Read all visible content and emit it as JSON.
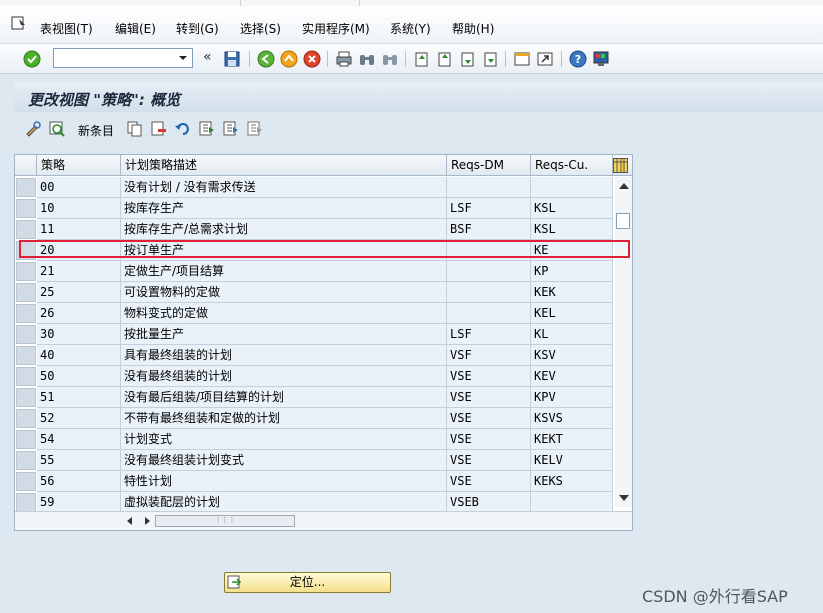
{
  "menubar": {
    "items": [
      "表视图(T)",
      "编辑(E)",
      "转到(G)",
      "选择(S)",
      "实用程序(M)",
      "系统(Y)",
      "帮助(H)"
    ]
  },
  "toolbar": {
    "command_value": "",
    "back_chevron": "«"
  },
  "title": "更改视图 \"策略\": 概览",
  "app_toolbar": {
    "new_entries_label": "新条目"
  },
  "table": {
    "columns": [
      "策略",
      "计划策略描述",
      "Reqs-DM",
      "Reqs-Cu."
    ],
    "rows": [
      {
        "strategy": "00",
        "desc": "没有计划 / 没有需求传送",
        "dm": "",
        "cu": ""
      },
      {
        "strategy": "10",
        "desc": "按库存生产",
        "dm": "LSF",
        "cu": "KSL"
      },
      {
        "strategy": "11",
        "desc": "按库存生产/总需求计划",
        "dm": "BSF",
        "cu": "KSL"
      },
      {
        "strategy": "20",
        "desc": "按订单生产",
        "dm": "",
        "cu": "KE"
      },
      {
        "strategy": "21",
        "desc": "定做生产/项目结算",
        "dm": "",
        "cu": "KP"
      },
      {
        "strategy": "25",
        "desc": "可设置物料的定做",
        "dm": "",
        "cu": "KEK"
      },
      {
        "strategy": "26",
        "desc": "物料变式的定做",
        "dm": "",
        "cu": "KEL"
      },
      {
        "strategy": "30",
        "desc": "按批量生产",
        "dm": "LSF",
        "cu": "KL"
      },
      {
        "strategy": "40",
        "desc": "具有最终组装的计划",
        "dm": "VSF",
        "cu": "KSV"
      },
      {
        "strategy": "50",
        "desc": "没有最终组装的计划",
        "dm": "VSE",
        "cu": "KEV"
      },
      {
        "strategy": "51",
        "desc": "没有最后组装/项目结算的计划",
        "dm": "VSE",
        "cu": "KPV"
      },
      {
        "strategy": "52",
        "desc": "不带有最终组装和定做的计划",
        "dm": "VSE",
        "cu": "KSVS"
      },
      {
        "strategy": "54",
        "desc": "计划变式",
        "dm": "VSE",
        "cu": "KEKT"
      },
      {
        "strategy": "55",
        "desc": "没有最终组装计划变式",
        "dm": "VSE",
        "cu": "KELV"
      },
      {
        "strategy": "56",
        "desc": "特性计划",
        "dm": "VSE",
        "cu": "KEKS"
      },
      {
        "strategy": "59",
        "desc": "虚拟装配层的计划",
        "dm": "VSEB",
        "cu": ""
      }
    ],
    "highlighted_row": "20",
    "highlight_color": "#e0203a"
  },
  "position_button_label": "定位...",
  "watermark": "CSDN @外行看SAP"
}
